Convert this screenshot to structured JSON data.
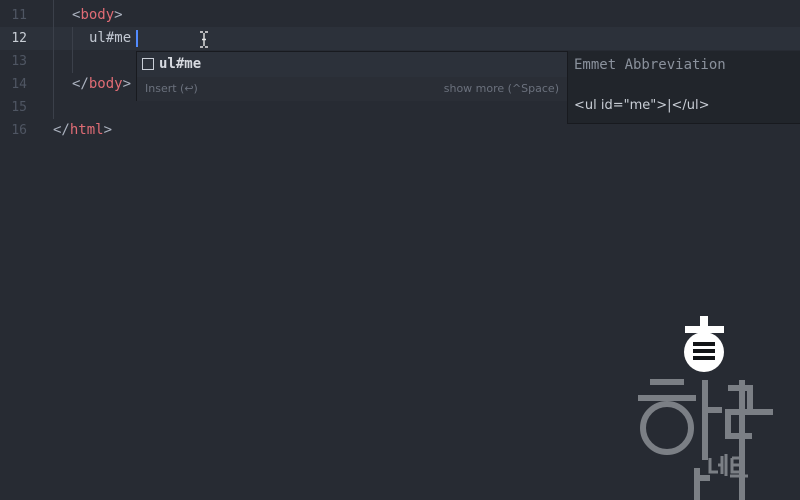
{
  "editor": {
    "line_numbers": [
      "11",
      "12",
      "13",
      "14",
      "15",
      "16"
    ],
    "lines": {
      "l11": {
        "open": "<",
        "tag": "body",
        "close": ">"
      },
      "l12": {
        "text": "ul#me"
      },
      "l14": {
        "open": "</",
        "tag": "body",
        "close": ">"
      },
      "l16": {
        "open": "</",
        "tag": "html",
        "close": ">"
      }
    }
  },
  "autocomplete": {
    "suggestion": "ul#me",
    "insert_hint": "Insert (↩)",
    "show_more_hint": "show more (^Space)",
    "icon": "snippet-square-icon"
  },
  "doc_panel": {
    "title": "Emmet Abbreviation",
    "snippet": "<ul id=\"me\">|</ul>"
  },
  "watermark": {
    "text": "하늘네트",
    "icon": "haneul-net-logo"
  },
  "colors": {
    "background": "#272b33",
    "tag": "#e06c75",
    "cursor": "#528bff",
    "popup": "#21252b"
  }
}
